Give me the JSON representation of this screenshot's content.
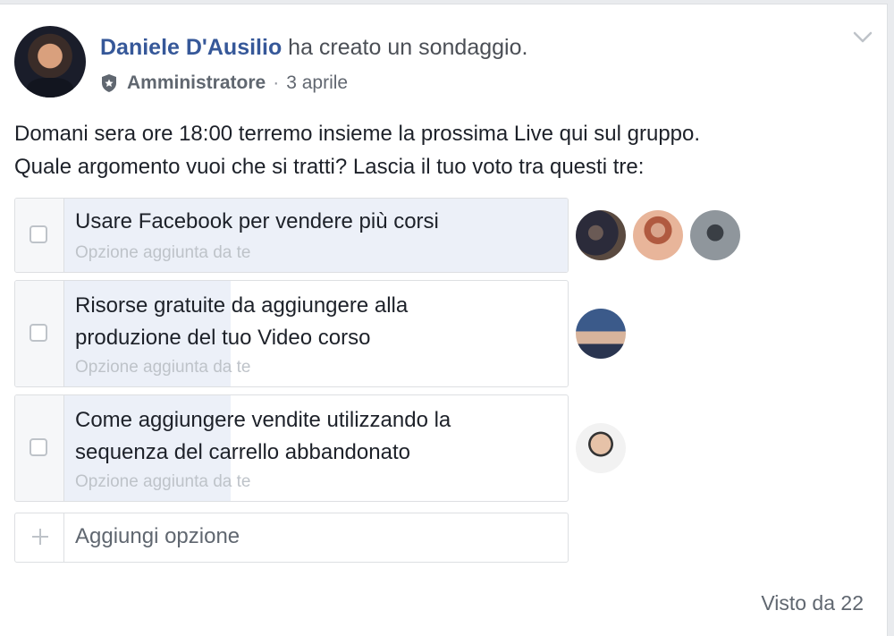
{
  "post": {
    "author": "Daniele D'Ausilio",
    "action": "ha creato un sondaggio.",
    "role": "Amministratore",
    "separator": "·",
    "date": "3 aprile",
    "text_lines": [
      "Domani sera ore 18:00 terremo insieme la prossima Live qui sul gruppo.",
      "Quale argomento vuoi che si tratti? Lascia il tuo voto tra questi tre:"
    ]
  },
  "poll": {
    "options": [
      {
        "label_lines": [
          "Usare Facebook per vendere più corsi"
        ],
        "sub": "Opzione aggiunta da te",
        "votes": 3,
        "vote_fraction": 1.0
      },
      {
        "label_lines": [
          "Risorse gratuite da aggiungere alla",
          "produzione del tuo Video corso"
        ],
        "sub": "Opzione aggiunta da te",
        "votes": 1,
        "vote_fraction": 0.33
      },
      {
        "label_lines": [
          "Come aggiungere vendite utilizzando la",
          "sequenza del carrello abbandonato"
        ],
        "sub": "Opzione aggiunta da te",
        "votes": 1,
        "vote_fraction": 0.33
      }
    ],
    "add_option_placeholder": "Aggiungi opzione"
  },
  "footer": {
    "seen": "Visto da 22"
  },
  "icons": {
    "role": "shield-icon",
    "menu": "chevron-down-icon",
    "add": "plus-icon"
  },
  "colors": {
    "author_link": "#365899",
    "vote_fill": "#ecf0f8"
  }
}
